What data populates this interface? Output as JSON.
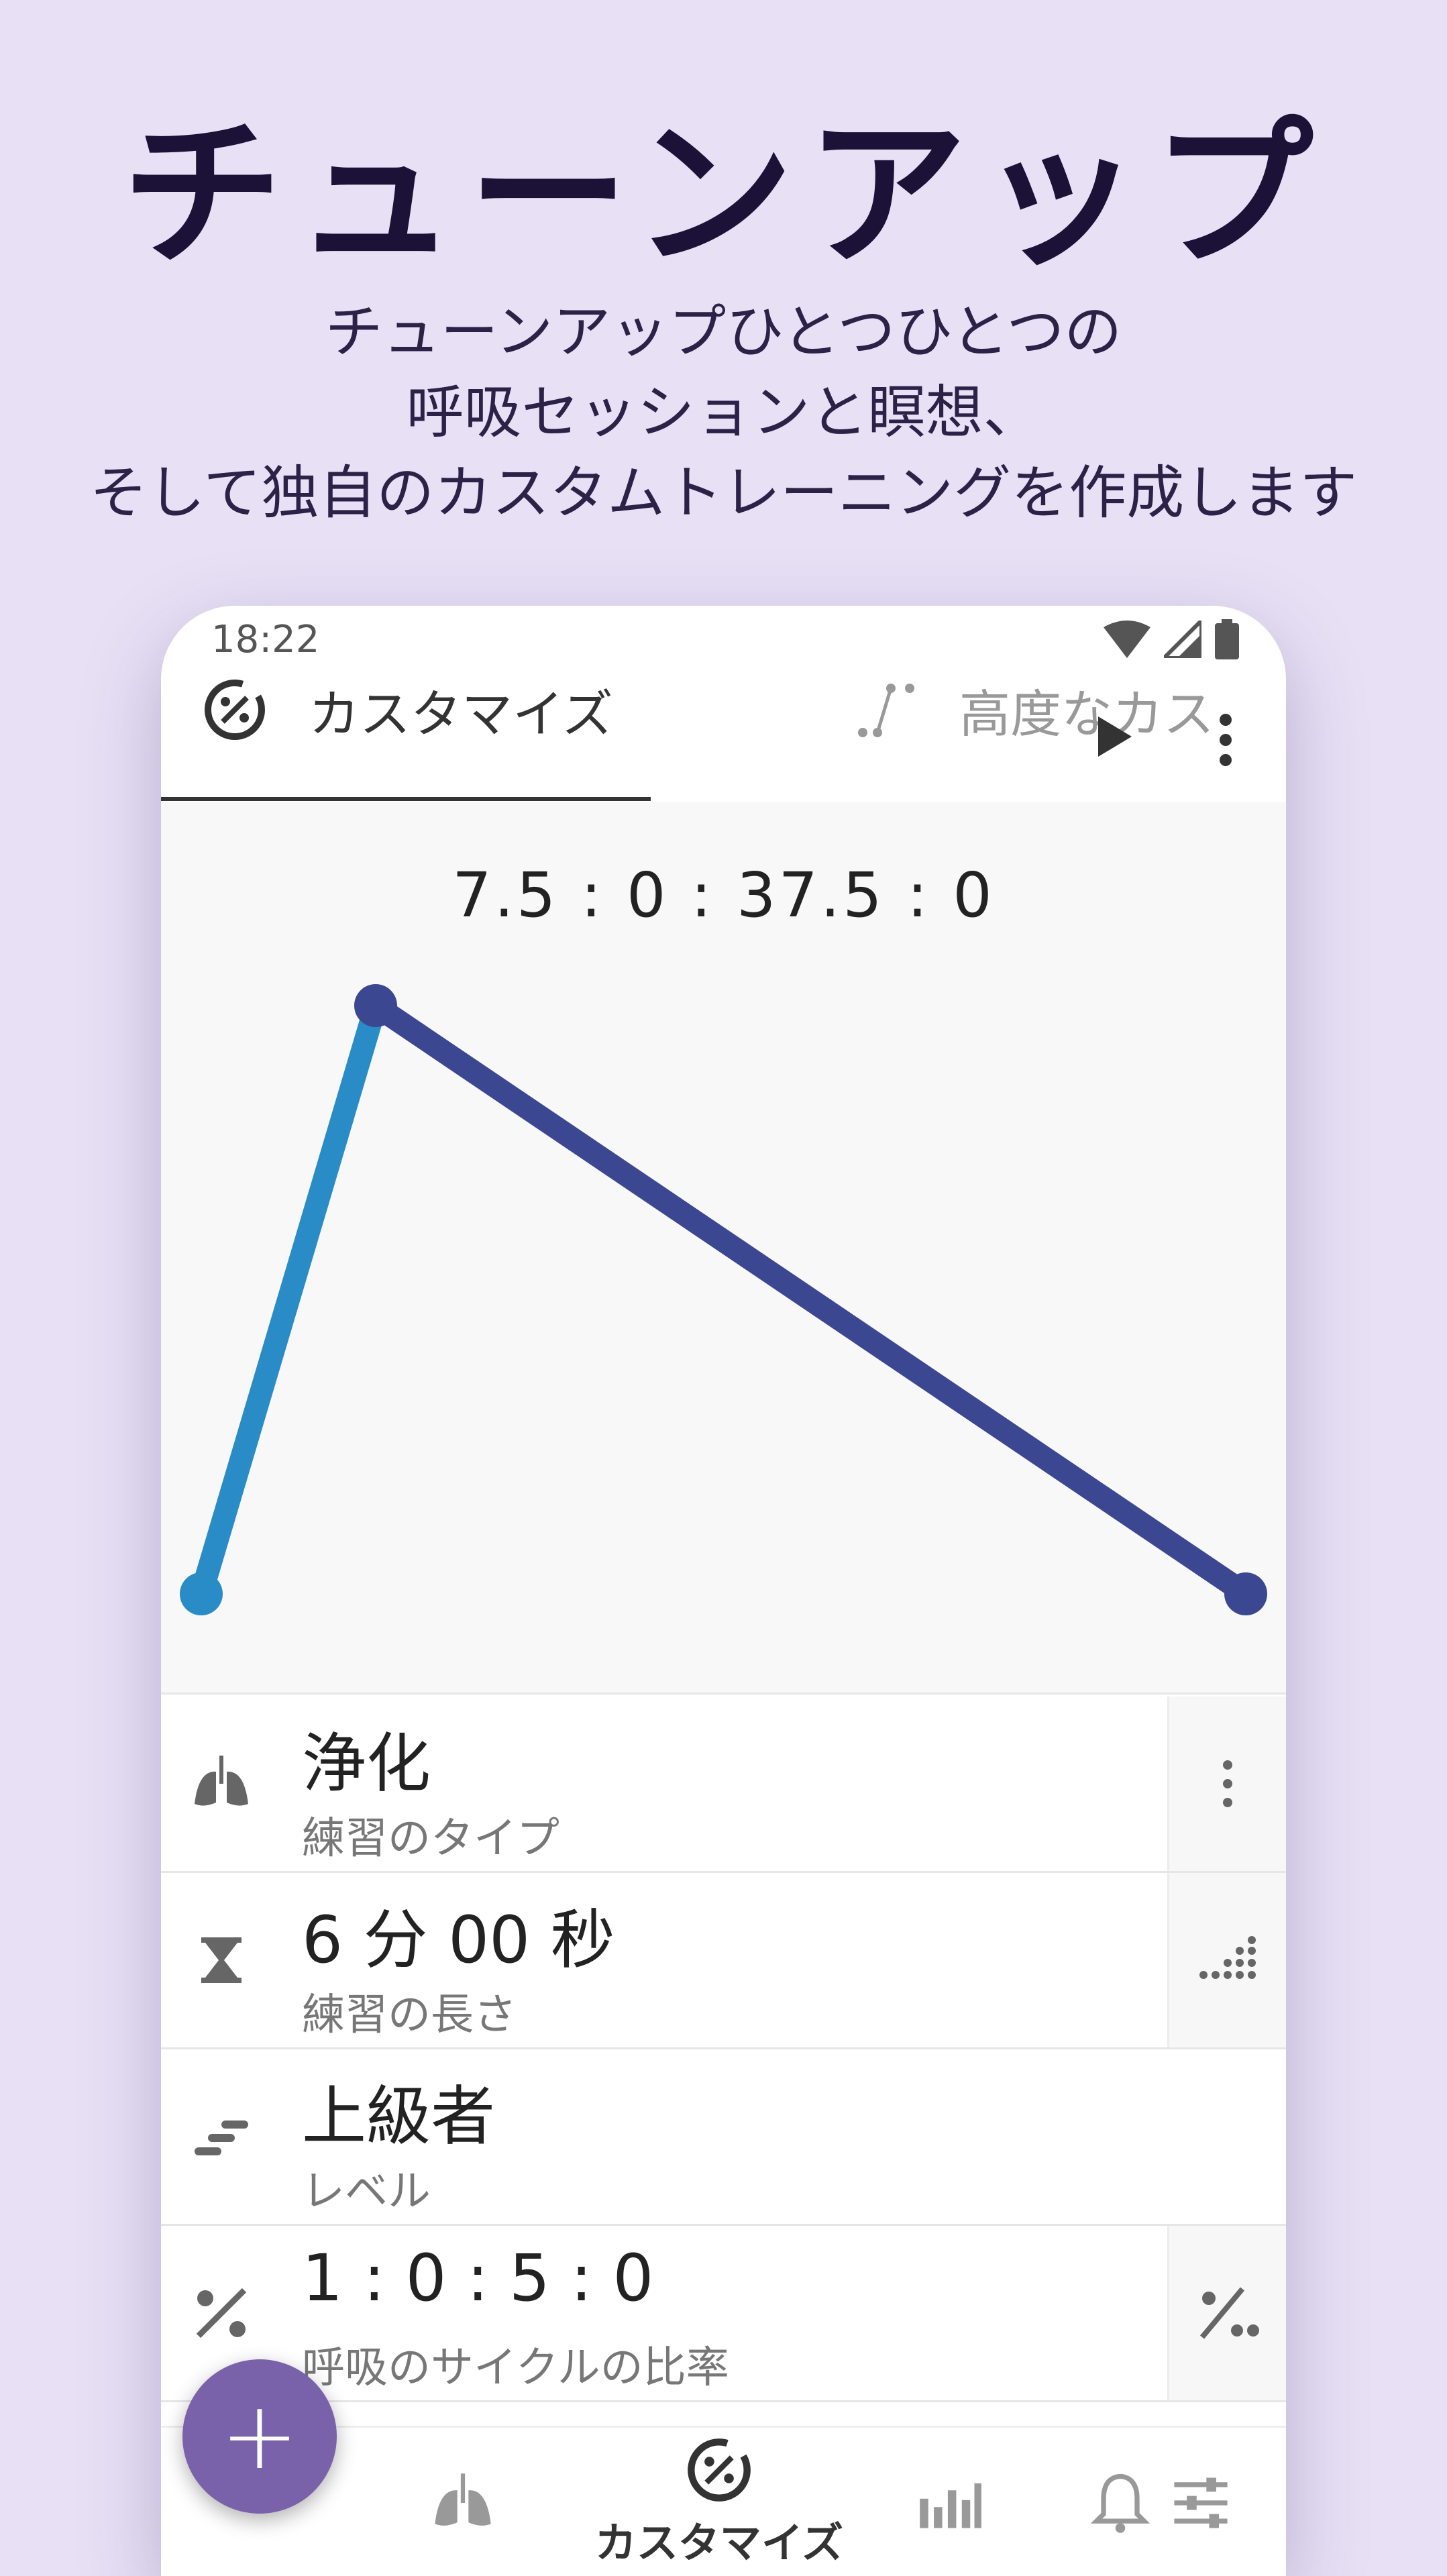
{
  "promo": {
    "title": "チューンアップ",
    "subtitle_line1": "チューンアップひとつひとつの",
    "subtitle_line2": "呼吸セッションと瞑想、",
    "subtitle_line3": "そして独自のカスタムトレーニングを作成します"
  },
  "status_bar": {
    "time": "18:22"
  },
  "tabs": {
    "custom_label": "カスタマイズ",
    "advanced_label": "高度なカス"
  },
  "chart": {
    "ratio_label": "7.5 : 0 : 37.5 : 0",
    "colors": {
      "inhale": "#2a8cc7",
      "exhale": "#3b4791"
    }
  },
  "settings": [
    {
      "title": "浄化",
      "subtitle": "練習のタイプ"
    },
    {
      "title": "6 分 00 秒",
      "subtitle": "練習の長さ"
    },
    {
      "title": "上級者",
      "subtitle": "レベル"
    },
    {
      "title": "1 : 0 : 5 : 0",
      "subtitle": "呼吸のサイクルの比率"
    }
  ],
  "bottom_nav": {
    "active_label": "カスタマイズ"
  },
  "fab": {
    "symbol": "+"
  }
}
